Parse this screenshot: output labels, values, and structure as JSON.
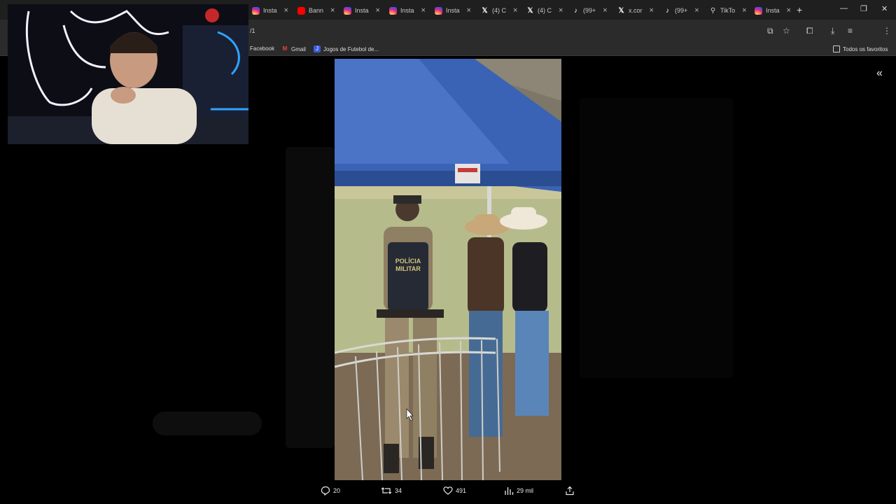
{
  "tabs": [
    {
      "label": "Insta",
      "icon": "instagram-icon",
      "kind": "insta"
    },
    {
      "label": "Bann",
      "icon": "youtube-icon",
      "kind": "yt"
    },
    {
      "label": "Insta",
      "icon": "instagram-icon",
      "kind": "insta"
    },
    {
      "label": "Insta",
      "icon": "instagram-icon",
      "kind": "insta"
    },
    {
      "label": "Insta",
      "icon": "instagram-icon",
      "kind": "insta"
    },
    {
      "label": "(4) C",
      "icon": "x-logo-icon",
      "kind": "xlogo"
    },
    {
      "label": "(4) C",
      "icon": "x-logo-icon",
      "kind": "xlogo"
    },
    {
      "label": "(99+",
      "icon": "tiktok-icon",
      "kind": "tiktok"
    },
    {
      "label": "x.cor",
      "icon": "x-logo-icon",
      "kind": "xlogo"
    },
    {
      "label": "(99+",
      "icon": "tiktok-icon",
      "kind": "tiktok"
    },
    {
      "label": "TikTo",
      "icon": "link-icon",
      "kind": "gen"
    },
    {
      "label": "Insta",
      "icon": "instagram-icon",
      "kind": "insta"
    }
  ],
  "address": {
    "text": "/1"
  },
  "bookmarks": {
    "items": [
      {
        "label": "Facebook"
      },
      {
        "label": "Gmail"
      },
      {
        "label": "Jogos de Futebol de..."
      }
    ],
    "all_label": "Todos os favoritos"
  },
  "actions": {
    "replies": "20",
    "reposts": "34",
    "likes": "491",
    "views": "29 mil"
  },
  "colors": {
    "tabbar": "#1f1f1f",
    "toolbar": "#2b2b2b",
    "page": "#000000"
  }
}
